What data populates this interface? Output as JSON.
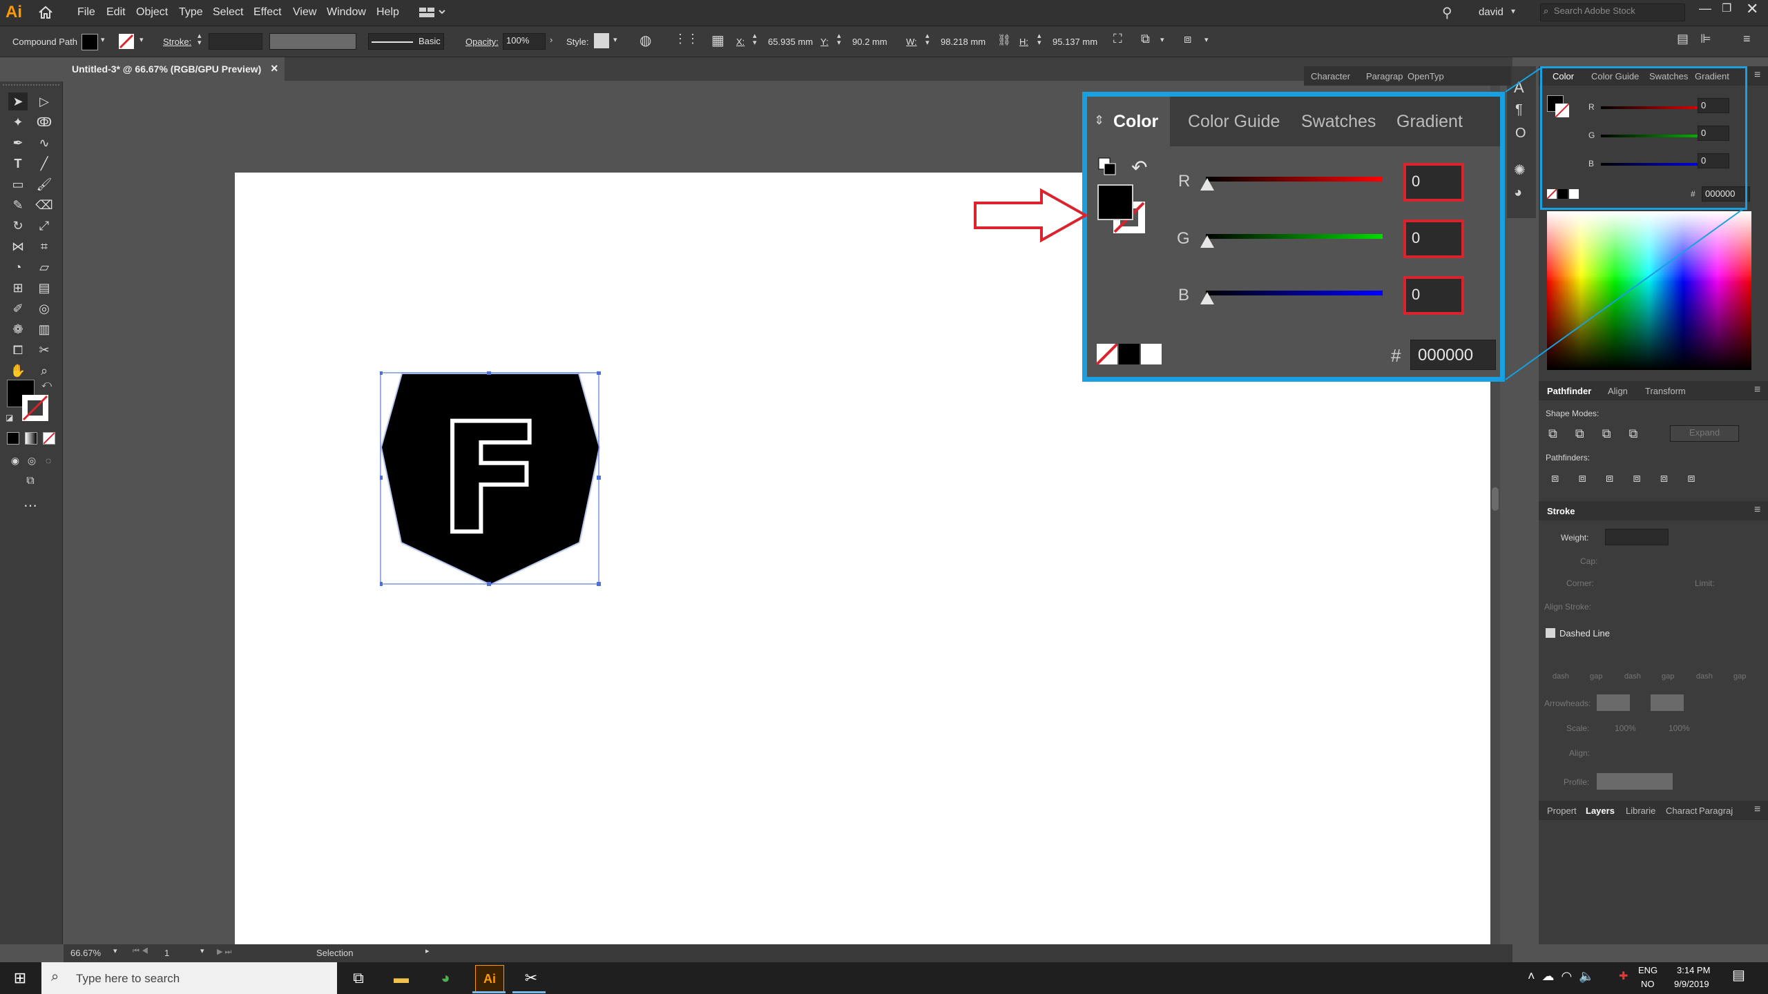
{
  "app": {
    "logo": "Ai",
    "user": "david",
    "search_placeholder": "Search Adobe Stock"
  },
  "menu": [
    "File",
    "Edit",
    "Object",
    "Type",
    "Select",
    "Effect",
    "View",
    "Window",
    "Help"
  ],
  "control_bar": {
    "selection_type": "Compound Path",
    "stroke_label": "Stroke:",
    "stroke_style": "Basic",
    "opacity_label": "Opacity:",
    "opacity_value": "100%",
    "style_label": "Style:",
    "x_label": "X:",
    "x_value": "65.935 mm",
    "y_label": "Y:",
    "y_value": "90.2 mm",
    "w_label": "W:",
    "w_value": "98.218 mm",
    "h_label": "H:",
    "h_value": "95.137 mm"
  },
  "document": {
    "tab_title": "Untitled-3* @ 66.67% (RGB/GPU Preview)",
    "close": "×",
    "artwork_letter": "F"
  },
  "right_tabs_top": [
    "Character",
    "Paragrap",
    "OpenTyp"
  ],
  "color_panel": {
    "tabs": [
      "Color",
      "Color Guide",
      "Swatches",
      "Gradient"
    ],
    "r_label": "R",
    "r_value": "0",
    "g_label": "G",
    "g_value": "0",
    "b_label": "B",
    "b_value": "0",
    "hash": "#",
    "hex": "000000"
  },
  "pathfinder": {
    "tabs": [
      "Pathfinder",
      "Align",
      "Transform"
    ],
    "shape_modes_label": "Shape Modes:",
    "pathfinders_label": "Pathfinders:",
    "expand_label": "Expand"
  },
  "stroke_panel": {
    "title": "Stroke",
    "weight_label": "Weight:",
    "cap_label": "Cap:",
    "corner_label": "Corner:",
    "limit_label": "Limit:",
    "align_label": "Align Stroke:",
    "dashed_line_label": "Dashed Line",
    "dash_labels": [
      "dash",
      "gap",
      "dash",
      "gap",
      "dash",
      "gap"
    ],
    "arrowheads_label": "Arrowheads:",
    "scale_label": "Scale:",
    "scale_1": "100%",
    "scale_2": "100%",
    "align2_label": "Align:",
    "profile_label": "Profile:"
  },
  "bottom_tabs": [
    "Propert",
    "Layers",
    "Librarie",
    "Charact",
    "Paragraj"
  ],
  "status": {
    "zoom": "66.67%",
    "artboard": "1",
    "tool": "Selection"
  },
  "taskbar": {
    "search_placeholder": "Type here to search",
    "lang": "ENG",
    "region": "NO",
    "time": "3:14 PM",
    "date": "9/9/2019"
  },
  "colors": {
    "accent": "#18a0e0",
    "annotation_red": "#d9232d",
    "fill": "#000000"
  }
}
